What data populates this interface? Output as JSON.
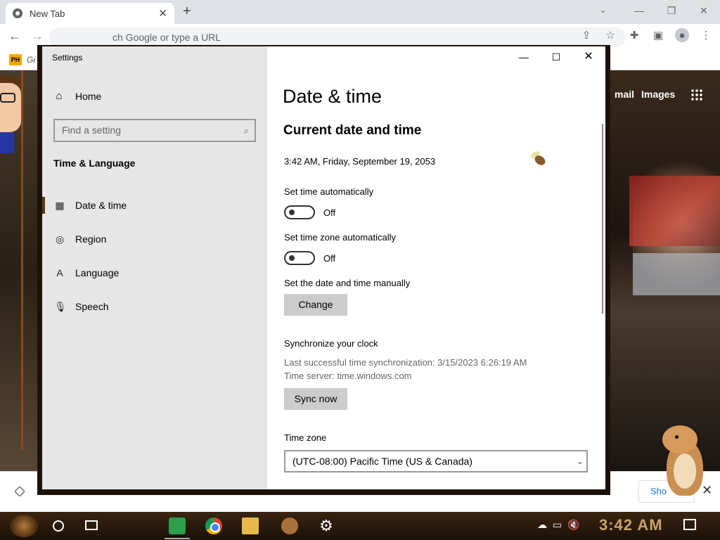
{
  "browser": {
    "tab_title": "New Tab",
    "omnibox_placeholder": "ch Google or type a URL",
    "bookmark_label": "Gi",
    "bookmark_icon_text": "PH",
    "google_links": [
      "mail",
      "Images"
    ],
    "show_button": "Sho"
  },
  "settings": {
    "window_title": "Settings",
    "sidebar": {
      "home": "Home",
      "search_placeholder": "Find a setting",
      "section": "Time & Language",
      "items": [
        {
          "label": "Date & time",
          "icon": "calendar-clock-icon",
          "active": true
        },
        {
          "label": "Region",
          "icon": "globe-icon",
          "active": false
        },
        {
          "label": "Language",
          "icon": "language-icon",
          "active": false
        },
        {
          "label": "Speech",
          "icon": "microphone-icon",
          "active": false
        }
      ]
    },
    "content": {
      "title": "Date & time",
      "section_heading": "Current date and time",
      "current_datetime": "3:42 AM, Friday, September 19, 2053",
      "set_time_auto_label": "Set time automatically",
      "set_time_auto_state": "Off",
      "set_tz_auto_label": "Set time zone automatically",
      "set_tz_auto_state": "Off",
      "manual_label": "Set the date and time manually",
      "change_button": "Change",
      "sync_heading": "Synchronize your clock",
      "last_sync": "Last successful time synchronization: 3/15/2023 6:26:19 AM",
      "time_server": "Time server: time.windows.com",
      "sync_button": "Sync now",
      "timezone_label": "Time zone",
      "timezone_value": "(UTC-08:00) Pacific Time (US & Canada)"
    }
  },
  "taskbar": {
    "clock": "3:42 AM"
  }
}
